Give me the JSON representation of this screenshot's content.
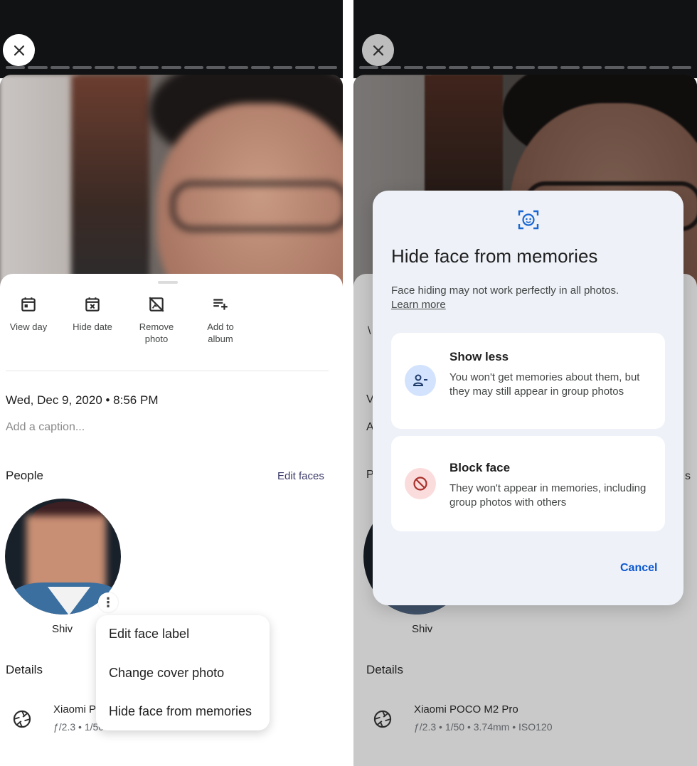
{
  "left_screen": {
    "actions": [
      {
        "label": "View day",
        "icon": "calendar-day-icon"
      },
      {
        "label": "Hide date",
        "icon": "calendar-hide-icon"
      },
      {
        "label": "Remove\nphoto",
        "icon": "remove-photo-icon"
      },
      {
        "label": "Add to\nalbum",
        "icon": "playlist-add-icon"
      }
    ],
    "date_time": "Wed, Dec 9, 2020 • 8:56 PM",
    "caption_placeholder": "Add a caption...",
    "people_heading": "People",
    "edit_faces": "Edit faces",
    "person_name": "Shiv",
    "details_heading": "Details",
    "camera_name": "Xiaomi POCO M2 Pro",
    "camera_specs": "ƒ/2.3 • 1/50 • 3.74mm • ISO120",
    "context_menu": [
      "Edit face label",
      "Change cover photo",
      "Hide face from memories"
    ]
  },
  "right_screen": {
    "dialog": {
      "title": "Hide face from memories",
      "body": "Face hiding may not work perfectly in all photos.",
      "link": "Learn more",
      "options": [
        {
          "title": "Show less",
          "description": "You won't get memories about them, but they may still appear in group photos",
          "icon": "person-remove-icon"
        },
        {
          "title": "Block face",
          "description": "They won't appear in memories, including group photos with others",
          "icon": "block-icon"
        }
      ],
      "cancel": "Cancel"
    },
    "person_name": "Shiv",
    "details_heading": "Details",
    "camera_name": "Xiaomi POCO M2 Pro",
    "camera_specs": "ƒ/2.3 • 1/50 • 3.74mm • ISO120"
  },
  "colors": {
    "accent": "#0b57d0",
    "dialog_bg": "#eef2f8",
    "topbar": "#111214",
    "show_less_badge": "#d3e3fd",
    "block_badge": "#fbdcdc"
  }
}
